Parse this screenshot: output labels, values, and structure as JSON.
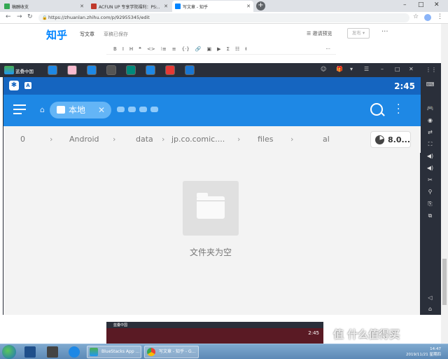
{
  "browser": {
    "tabs": [
      {
        "title": "稿酬收支",
        "color": "#34a853"
      },
      {
        "title": "ACFUN UP 专享学院福利：PS:..",
        "color": "#c0392b"
      },
      {
        "title": "写文章 - 知乎",
        "color": "#0084ff"
      }
    ],
    "new_tab": "+",
    "url": "https://zhuanlan.zhihu.com/p/92955345/edit",
    "min": "–",
    "max": "□",
    "close": "✕"
  },
  "zhihu": {
    "logo": "知乎",
    "write_label": "写文章",
    "draft_status": "草稿已保存",
    "invite_preview": "☰ 邀请预览",
    "publish": "发布 ▾",
    "more": "···",
    "toolbar": [
      "B",
      "I",
      "H",
      "❝",
      "<>",
      "⁝≡",
      "≡",
      "{·}",
      "🔗",
      "▣",
      "▶",
      "Σ",
      "☷",
      "Ɨ"
    ],
    "toolbar_more": "···"
  },
  "bluestacks": {
    "title": "蓝叠中国",
    "apps": [
      {
        "name": "app-1",
        "color": "#1e88e5"
      },
      {
        "name": "app-2",
        "color": "#f8bbd0"
      },
      {
        "name": "app-3",
        "color": "#1e88e5"
      },
      {
        "name": "app-4",
        "color": "#555555"
      },
      {
        "name": "app-5",
        "color": "#00897b"
      },
      {
        "name": "app-6",
        "color": "#1e88e5"
      },
      {
        "name": "app-7",
        "color": "#e53935"
      },
      {
        "name": "app-8",
        "color": "#1976d2"
      }
    ],
    "controls": [
      "☺",
      "🎁",
      "▾",
      "☰",
      "–",
      "□",
      "✕"
    ],
    "side_icons": [
      "⋮⋮",
      "⌨",
      "🎮",
      "◉",
      "⇄",
      "⛶",
      "◀)",
      "◀)",
      "✂",
      "⚲",
      "⎘",
      "⧉",
      "◁",
      "⌂"
    ]
  },
  "android": {
    "status_time": "2:45",
    "location_chip": "本地",
    "chip_close": "✕",
    "breadcrumbs": [
      "0",
      "Android",
      "data",
      "jp.co.comic....",
      "files",
      "al"
    ],
    "storage_label": "8.0...",
    "empty_message": "文件夹为空"
  },
  "mini_window": {
    "title": "蓝叠中国",
    "time": "2:45"
  },
  "taskbar": {
    "buttons": [
      "BlueStacks App ...",
      "写文章 - 知乎 - G..."
    ],
    "time": "14:47",
    "date": "2019/11/21 星期四"
  },
  "watermark": "值 什么值得买"
}
